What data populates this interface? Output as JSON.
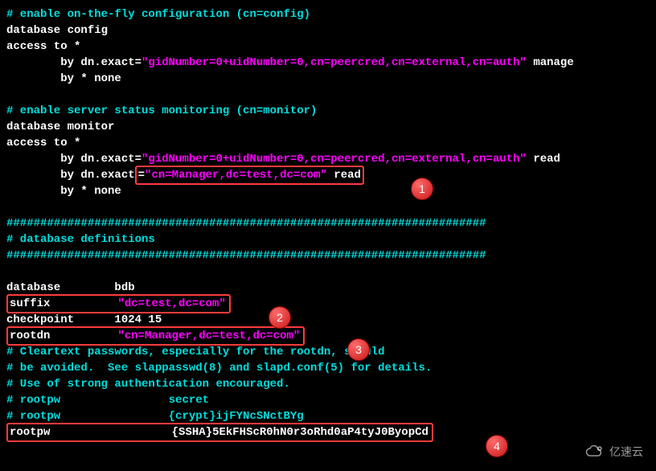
{
  "config": {
    "comment_config": "# enable on-the-fly configuration (cn=config)",
    "db_config": "database config",
    "access_to": "access to *",
    "by_dn_exact_prefix": "        by dn.exact=",
    "dn_exact_value": "\"gidNumber=0+uidNumber=0,cn=peercred,cn=external,cn=auth\"",
    "manage": " manage",
    "by_star_none": "        by * none",
    "comment_monitor": "# enable server status monitoring (cn=monitor)",
    "db_monitor": "database monitor",
    "by_dn_exact2": "        by dn.exact",
    "eq": "=",
    "dn_manager_value": "\"cn=Manager,dc=test,dc=com\"",
    "read": " read",
    "hash_line": "#######################################################################",
    "db_definitions": "# database definitions",
    "db_bdb_label": "database",
    "db_bdb_value": "        bdb",
    "suffix_label": "suffix",
    "suffix_spacer": "          ",
    "suffix_value": "\"dc=test,dc=com\"",
    "checkpoint_label": "checkpoint",
    "checkpoint_value": "      1024 15",
    "rootdn_label": "rootdn",
    "rootdn_spacer": "          ",
    "rootdn_value": "\"cn=Manager,dc=test,dc=com\"",
    "cleartext1": "# Cleartext passwords, especially for the rootdn, should",
    "cleartext2": "# be avoided.  See slappasswd(8) and slapd.conf(5) for details.",
    "cleartext3": "# Use of strong authentication encouraged.",
    "rootpw_c1_label": "# rootpw",
    "rootpw_c1_value": "                secret",
    "rootpw_c2_label": "# rootpw",
    "rootpw_c2_value": "                {crypt}ijFYNcSNctBYg",
    "rootpw_label": "rootpw",
    "rootpw_spacer": "                  ",
    "rootpw_value": "{SSHA}5EkFHScR0hN0r3oRhd0aP4tyJ0ByopCd"
  },
  "badges": {
    "b1": "1",
    "b2": "2",
    "b3": "3",
    "b4": "4"
  },
  "logo_text": "亿速云"
}
